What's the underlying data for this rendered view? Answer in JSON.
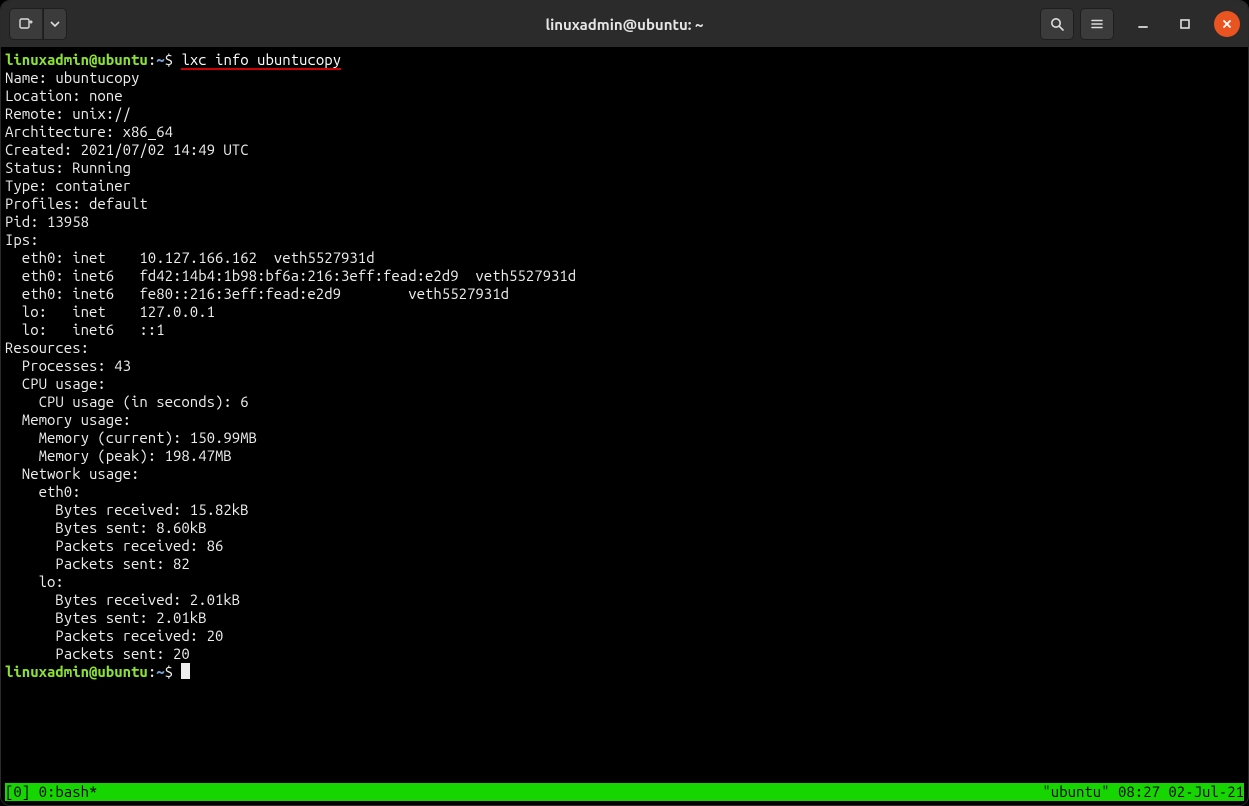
{
  "window": {
    "title": "linuxadmin@ubuntu: ~"
  },
  "prompt": {
    "user_host": "linuxadmin@ubuntu",
    "sep": ":",
    "path": "~",
    "symbol": "$"
  },
  "command": {
    "text": "lxc info ubuntucopy"
  },
  "output": {
    "info": [
      "Name: ubuntucopy",
      "Location: none",
      "Remote: unix://",
      "Architecture: x86_64",
      "Created: 2021/07/02 14:49 UTC",
      "Status: Running",
      "Type: container",
      "Profiles: default",
      "Pid: 13958"
    ],
    "ips_header": "Ips:",
    "ips": [
      "  eth0: inet    10.127.166.162  veth5527931d",
      "  eth0: inet6   fd42:14b4:1b98:bf6a:216:3eff:fead:e2d9  veth5527931d",
      "  eth0: inet6   fe80::216:3eff:fead:e2d9        veth5527931d",
      "  lo:   inet    127.0.0.1",
      "  lo:   inet6   ::1"
    ],
    "resources_header": "Resources:",
    "resources": [
      "  Processes: 43",
      "  CPU usage:",
      "    CPU usage (in seconds): 6",
      "  Memory usage:",
      "    Memory (current): 150.99MB",
      "    Memory (peak): 198.47MB",
      "  Network usage:",
      "    eth0:",
      "      Bytes received: 15.82kB",
      "      Bytes sent: 8.60kB",
      "      Packets received: 86",
      "      Packets sent: 82",
      "    lo:",
      "      Bytes received: 2.01kB",
      "      Bytes sent: 2.01kB",
      "      Packets received: 20",
      "      Packets sent: 20"
    ]
  },
  "statusbar": {
    "left": "[0] 0:bash*",
    "right": "\"ubuntu\" 08:27 02-Jul-21"
  }
}
